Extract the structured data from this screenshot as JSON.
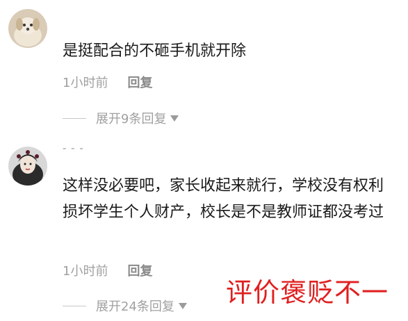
{
  "comments": [
    {
      "avatar_icon": "dog-avatar-icon",
      "username": "",
      "text": "是挺配合的不砸手机就开除",
      "time": "1小时前",
      "reply_label": "回复",
      "expand_label": "展开9条回复"
    },
    {
      "avatar_icon": "woman-portrait-avatar-icon",
      "username": "- - -",
      "text": "这样没必要吧，家长收起来就行，学校没有权利损坏学生个人财产，校长是不是教师证都没考过",
      "time": "1小时前",
      "reply_label": "回复",
      "expand_label": "展开24条回复"
    }
  ],
  "overlay_caption": "评价褒贬不一",
  "colors": {
    "caption": "#e02020",
    "muted": "#a0a0a0"
  }
}
